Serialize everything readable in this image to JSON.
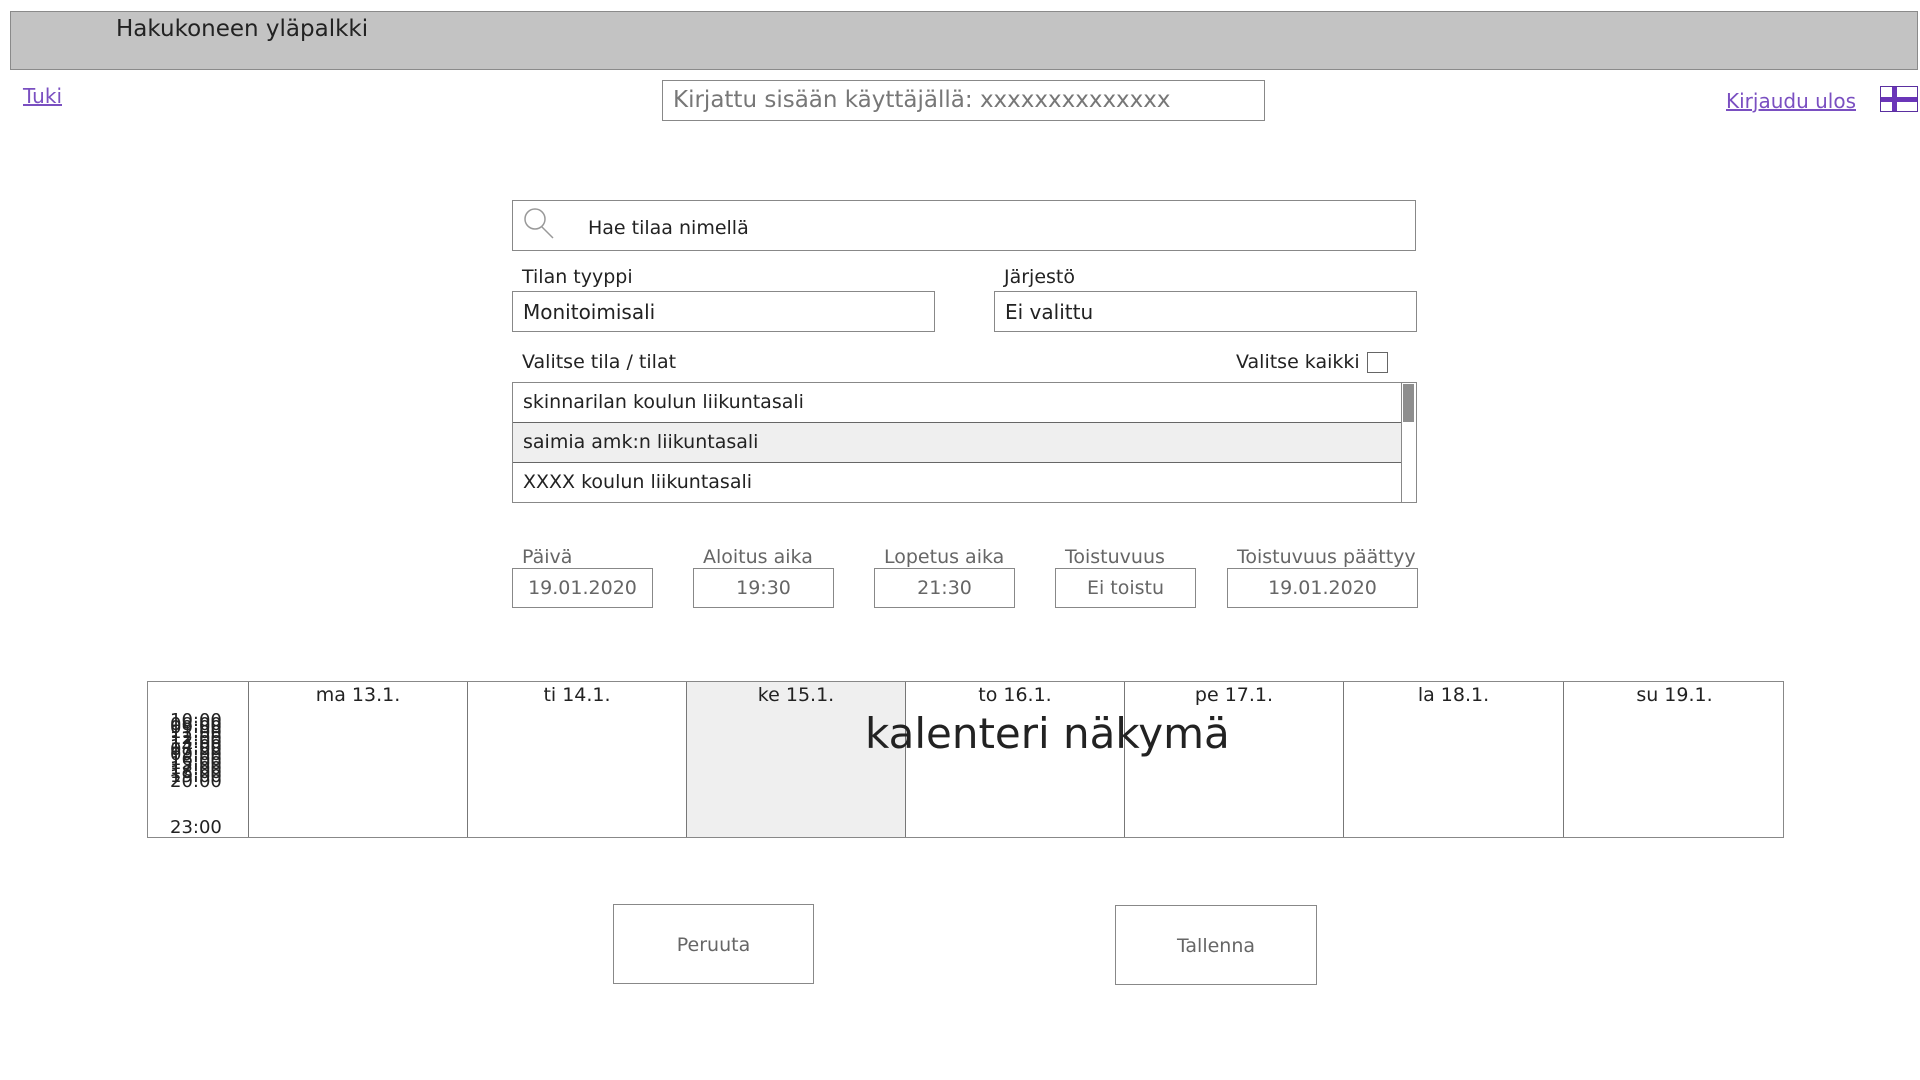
{
  "topbar": {
    "title": "Hakukoneen yläpalkki"
  },
  "nav": {
    "support": "Tuki",
    "login_status": "Kirjattu sisään käyttäjällä: xxxxxxxxxxxxxx",
    "logout": "Kirjaudu ulos",
    "language_icon": "finnish-flag-icon"
  },
  "search": {
    "placeholder": "Hae tilaa nimellä",
    "icon": "search-icon"
  },
  "filters": {
    "type_label": "Tilan tyyppi",
    "type_value": "Monitoimisali",
    "org_label": "Järjestö",
    "org_value": "Ei valittu"
  },
  "rooms": {
    "label": "Valitse tila / tilat",
    "select_all_label": "Valitse kaikki",
    "items": [
      "skinnarilan koulun liikuntasali",
      "saimia amk:n liikuntasali",
      "XXXX koulun liikuntasali"
    ]
  },
  "datetime": {
    "day_label": "Päivä",
    "day_value": "19.01.2020",
    "start_label": "Aloitus aika",
    "start_value": "19:30",
    "end_label": "Lopetus aika",
    "end_value": "21:30",
    "repeat_label": "Toistuvuus",
    "repeat_value": "Ei toistu",
    "repeat_end_label": "Toistuvuus päättyy",
    "repeat_end_value": "19.01.2020"
  },
  "calendar": {
    "title": "kalenteri näkymä",
    "days": [
      "ma 13.1.",
      "ti 14.1.",
      "ke 15.1.",
      "to 16.1.",
      "pe 17.1.",
      "la 18.1.",
      "su 19.1."
    ],
    "times": [
      "10:00",
      "08:00",
      "09:00",
      "11:00",
      "12:00",
      "13:00",
      "14:00",
      "07:00",
      "09:00",
      "16:00",
      "15:00",
      "17:00",
      "18:00",
      "19:00",
      "20:00",
      "23:00"
    ]
  },
  "buttons": {
    "cancel": "Peruuta",
    "save": "Tallenna"
  }
}
